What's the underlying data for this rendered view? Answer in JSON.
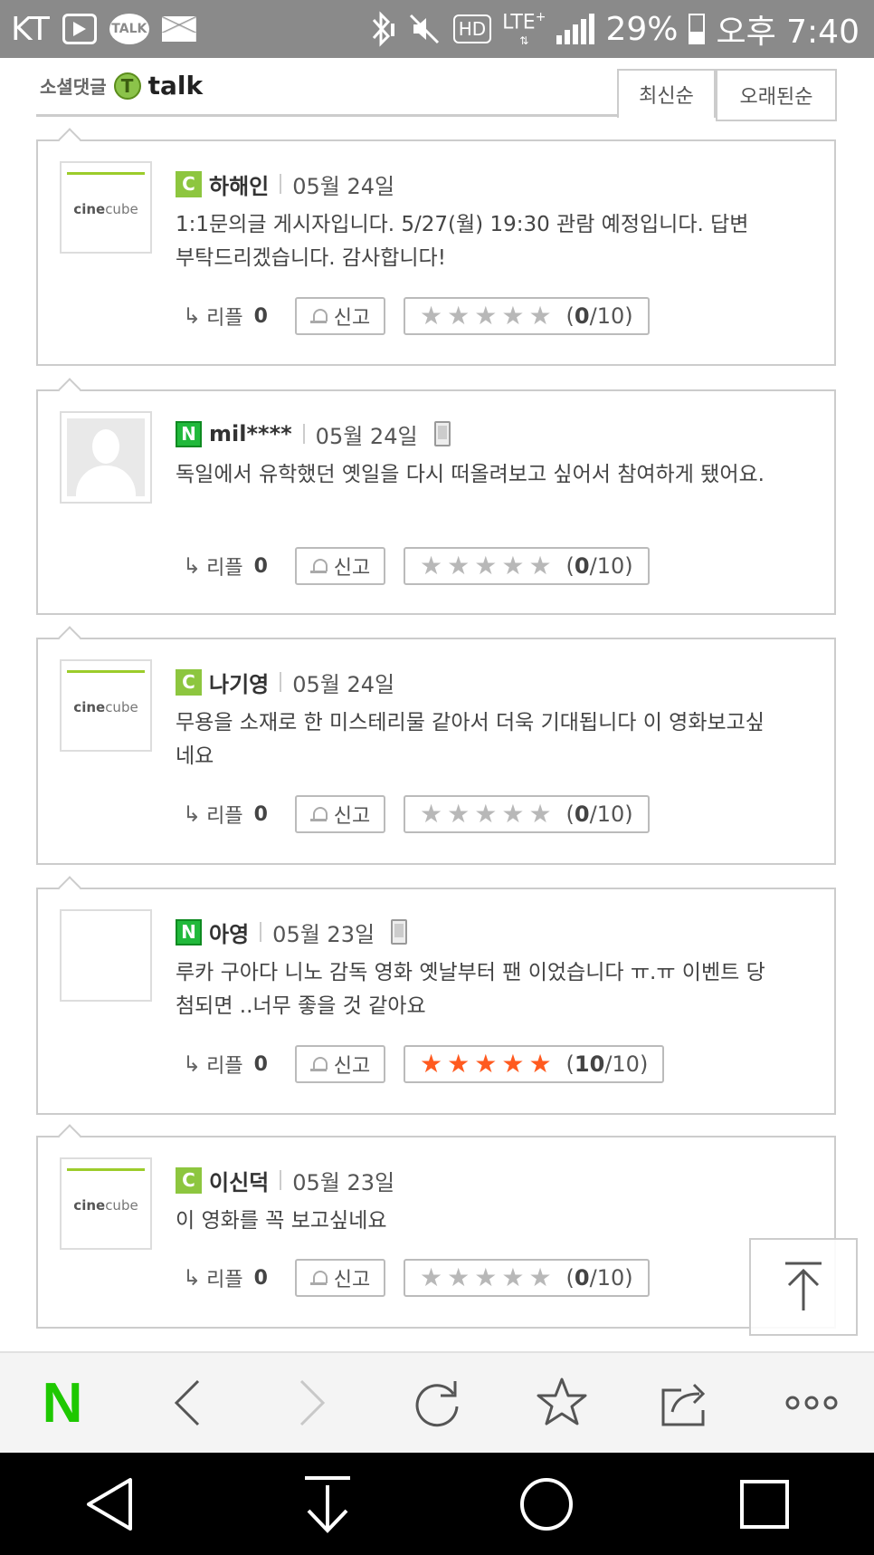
{
  "status_bar": {
    "carrier": "KT",
    "talk_label": "TALK",
    "hd_label": "HD",
    "lte_label": "LTE",
    "lte_plus": "+",
    "battery": "29%",
    "time": "오후 7:40"
  },
  "header": {
    "logo_korean": "소셜댓글",
    "logo_badge": "T",
    "logo_english": "talk",
    "sort_latest": "최신순",
    "sort_oldest": "오래된순"
  },
  "comments": [
    {
      "source": "C",
      "avatar": "cinecube",
      "avatar_text_a": "cine",
      "avatar_text_b": "cube",
      "author": "하해인",
      "date": "05월 24일",
      "mobile": false,
      "text": "1:1문의글 게시자입니다. 5/27(월) 19:30 관람 예정입니다. 답변 부탁드리겠습니다. 감사합니다!",
      "reply_label": "리플",
      "reply_count": "0",
      "report_label": "신고",
      "rating": 0,
      "score_value": "0",
      "score_max": "/10"
    },
    {
      "source": "N",
      "avatar": "default",
      "author": "mil****",
      "date": "05월 24일",
      "mobile": true,
      "text": "독일에서 유학했던 옛일을 다시 떠올려보고 싶어서 참여하게 됐어요.",
      "reply_label": "리플",
      "reply_count": "0",
      "report_label": "신고",
      "rating": 0,
      "score_value": "0",
      "score_max": "/10"
    },
    {
      "source": "C",
      "avatar": "cinecube",
      "avatar_text_a": "cine",
      "avatar_text_b": "cube",
      "author": "나기영",
      "date": "05월 24일",
      "mobile": false,
      "text": "무용을 소재로 한 미스테리물 같아서 더욱 기대됩니다 이 영화보고싶네요",
      "reply_label": "리플",
      "reply_count": "0",
      "report_label": "신고",
      "rating": 0,
      "score_value": "0",
      "score_max": "/10"
    },
    {
      "source": "N",
      "avatar": "blank",
      "author": "아영",
      "date": "05월 23일",
      "mobile": true,
      "text": "루카 구아다 니노 감독 영화 옛날부터 팬 이었습니다 ㅠ.ㅠ 이벤트 당첨되면 ..너무 좋을 것 같아요",
      "reply_label": "리플",
      "reply_count": "0",
      "report_label": "신고",
      "rating": 5,
      "score_value": "10",
      "score_max": "/10"
    },
    {
      "source": "C",
      "avatar": "cinecube",
      "avatar_text_a": "cine",
      "avatar_text_b": "cube",
      "author": "이신덕",
      "date": "05월 23일",
      "mobile": false,
      "text": "이 영화를 꼭 보고싶네요",
      "reply_label": "리플",
      "reply_count": "0",
      "report_label": "신고",
      "rating": 0,
      "score_value": "0",
      "score_max": "/10"
    }
  ],
  "toolbar": {
    "home_logo": "N",
    "icons": [
      "naver-home-icon",
      "back-icon",
      "forward-icon",
      "refresh-icon",
      "bookmark-star-icon",
      "share-icon",
      "more-icon"
    ]
  },
  "navbar": {
    "icons": [
      "nav-back-icon",
      "nav-download-icon",
      "nav-home-icon",
      "nav-recents-icon"
    ]
  },
  "colors": {
    "star_on": "#ff5a1f",
    "star_off": "#b8b8b8",
    "naver_green": "#1ec800",
    "cafe_green": "#8dc63f"
  }
}
